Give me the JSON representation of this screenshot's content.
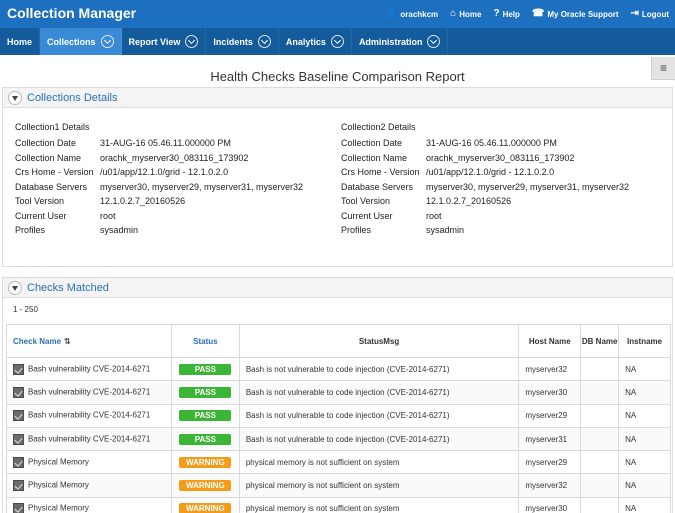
{
  "app": {
    "title": "Collection Manager"
  },
  "top_links": [
    {
      "icon": "user-icon",
      "glyph": "👤",
      "label": "orachkcm"
    },
    {
      "icon": "home-icon",
      "glyph": "⌂",
      "label": "Home"
    },
    {
      "icon": "help-icon",
      "glyph": "?",
      "label": "Help"
    },
    {
      "icon": "phone-icon",
      "glyph": "☎",
      "label": "My Oracle Support"
    },
    {
      "icon": "logout-icon",
      "glyph": "⇥",
      "label": "Logout"
    }
  ],
  "nav": [
    {
      "label": "Home",
      "dropdown": false,
      "active": false
    },
    {
      "label": "Collections",
      "dropdown": true,
      "active": true
    },
    {
      "label": "Report View",
      "dropdown": true,
      "active": false
    },
    {
      "label": "Incidents",
      "dropdown": true,
      "active": false
    },
    {
      "label": "Analytics",
      "dropdown": true,
      "active": false
    },
    {
      "label": "Administration",
      "dropdown": true,
      "active": false
    }
  ],
  "report": {
    "title": "Health Checks Baseline Comparison Report",
    "menu_glyph": "≡"
  },
  "details": {
    "title": "Collections Details",
    "collection1": {
      "header": "Collection1 Details",
      "rows": [
        {
          "label": "Collection Date",
          "value": "31-AUG-16 05.46.11.000000 PM"
        },
        {
          "label": "Collection Name",
          "value": "orachk_myserver30_083116_173902"
        },
        {
          "label": "Crs Home - Version",
          "value": "/u01/app/12.1.0/grid - 12.1.0.2.0"
        },
        {
          "label": "Database Servers",
          "value": "myserver30, myserver29, myserver31, myserver32"
        },
        {
          "label": "Tool Version",
          "value": "12.1.0.2.7_20160526"
        },
        {
          "label": "Current User",
          "value": "root"
        },
        {
          "label": "Profiles",
          "value": "sysadmin"
        }
      ]
    },
    "collection2": {
      "header": "Collection2 Details",
      "rows": [
        {
          "label": "Collection Date",
          "value": "31-AUG-16 05.46.11.000000 PM"
        },
        {
          "label": "Collection Name",
          "value": "orachk_myserver30_083116_173902"
        },
        {
          "label": "Crs Home - Version",
          "value": "/u01/app/12.1.0/grid - 12.1.0.2.0"
        },
        {
          "label": "Database Servers",
          "value": "myserver30, myserver29, myserver31, myserver32"
        },
        {
          "label": "Tool Version",
          "value": "12.1.0.2.7_20160526"
        },
        {
          "label": "Current User",
          "value": "root"
        },
        {
          "label": "Profiles",
          "value": "sysadmin"
        }
      ]
    }
  },
  "checks": {
    "title": "Checks Matched",
    "range": "1 - 250",
    "columns": {
      "check_name": "Check Name",
      "status": "Status",
      "status_msg": "StatusMsg",
      "host_name": "Host Name",
      "db_name": "DB Name",
      "instname": "Instname"
    },
    "status_colors": {
      "PASS": "#3bb535",
      "WARNING": "#f49b1a"
    },
    "rows": [
      {
        "check": "Bash vulnerability CVE-2014-6271",
        "status": "PASS",
        "msg": "Bash is not vulnerable to code injection (CVE-2014-6271)",
        "host": "myserver32",
        "db": "",
        "inst": "NA"
      },
      {
        "check": "Bash vulnerability CVE-2014-6271",
        "status": "PASS",
        "msg": "Bash is not vulnerable to code injection (CVE-2014-6271)",
        "host": "myserver30",
        "db": "",
        "inst": "NA"
      },
      {
        "check": "Bash vulnerability CVE-2014-6271",
        "status": "PASS",
        "msg": "Bash is not vulnerable to code injection (CVE-2014-6271)",
        "host": "myserver29",
        "db": "",
        "inst": "NA"
      },
      {
        "check": "Bash vulnerability CVE-2014-6271",
        "status": "PASS",
        "msg": "Bash is not vulnerable to code injection (CVE-2014-6271)",
        "host": "myserver31",
        "db": "",
        "inst": "NA"
      },
      {
        "check": "Physical Memory",
        "status": "WARNING",
        "msg": "physical memory is not sufficient on system",
        "host": "myserver29",
        "db": "",
        "inst": "NA"
      },
      {
        "check": "Physical Memory",
        "status": "WARNING",
        "msg": "physical memory is not sufficient on system",
        "host": "myserver32",
        "db": "",
        "inst": "NA"
      },
      {
        "check": "Physical Memory",
        "status": "WARNING",
        "msg": "physical memory is not sufficient on system",
        "host": "myserver30",
        "db": "",
        "inst": "NA"
      }
    ]
  }
}
